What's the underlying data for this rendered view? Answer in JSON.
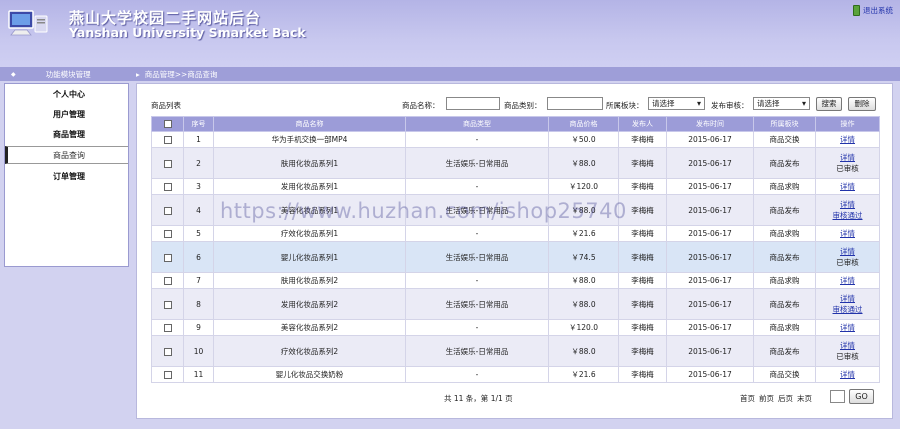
{
  "header": {
    "title_cn": "燕山大学校园二手网站后台",
    "title_en": "Yanshan University Smarket Back",
    "logout_label": "退出系统",
    "logo_icon": "monitor-icon"
  },
  "nav": {
    "left_bullet": "◆",
    "left_label": "功能模块管理",
    "right_arrow": "▸",
    "breadcrumb": "商品管理>>商品查询"
  },
  "sidebar": {
    "items": [
      {
        "label": "个人中心"
      },
      {
        "label": "用户管理"
      },
      {
        "label": "商品管理"
      },
      {
        "label": "商品查询"
      },
      {
        "label": "订单管理"
      }
    ]
  },
  "filter": {
    "list_title": "商品列表",
    "name_label": "商品名称：",
    "type_label": "商品类别：",
    "block_label": "所属板块：",
    "block_value": "请选择",
    "audit_label": "发布审核：",
    "audit_value": "请选择",
    "search_label": "搜索",
    "delete_label": "删除"
  },
  "table": {
    "headers": [
      "",
      "序号",
      "商品名称",
      "商品类型",
      "商品价格",
      "发布人",
      "发布时间",
      "所属板块",
      "操作"
    ],
    "rows": [
      {
        "no": "1",
        "name": "华为手机交换一部MP4",
        "type": "-",
        "price": "￥50.0",
        "publisher": "李梅梅",
        "date": "2015-06-17",
        "block": "商品交换",
        "op1": "详情",
        "op2": ""
      },
      {
        "no": "2",
        "name": "肤用化妆品系列1",
        "type": "生活娱乐-日常用品",
        "price": "￥88.0",
        "publisher": "李梅梅",
        "date": "2015-06-17",
        "block": "商品发布",
        "op1": "详情",
        "op2": "已审核"
      },
      {
        "no": "3",
        "name": "发用化妆品系列1",
        "type": "-",
        "price": "￥120.0",
        "publisher": "李梅梅",
        "date": "2015-06-17",
        "block": "商品求购",
        "op1": "详情",
        "op2": ""
      },
      {
        "no": "4",
        "name": "美容化妆品系列1",
        "type": "生活娱乐-日常用品",
        "price": "￥88.0",
        "publisher": "李梅梅",
        "date": "2015-06-17",
        "block": "商品发布",
        "op1": "详情",
        "op2": "审核通过"
      },
      {
        "no": "5",
        "name": "疗效化妆品系列1",
        "type": "-",
        "price": "￥21.6",
        "publisher": "李梅梅",
        "date": "2015-06-17",
        "block": "商品求购",
        "op1": "详情",
        "op2": ""
      },
      {
        "no": "6",
        "name": "婴儿化妆品系列1",
        "type": "生活娱乐-日常用品",
        "price": "￥74.5",
        "publisher": "李梅梅",
        "date": "2015-06-17",
        "block": "商品发布",
        "op1": "详情",
        "op2": "已审核"
      },
      {
        "no": "7",
        "name": "肤用化妆品系列2",
        "type": "-",
        "price": "￥88.0",
        "publisher": "李梅梅",
        "date": "2015-06-17",
        "block": "商品求购",
        "op1": "详情",
        "op2": ""
      },
      {
        "no": "8",
        "name": "发用化妆品系列2",
        "type": "生活娱乐-日常用品",
        "price": "￥88.0",
        "publisher": "李梅梅",
        "date": "2015-06-17",
        "block": "商品发布",
        "op1": "详情",
        "op2": "审核通过"
      },
      {
        "no": "9",
        "name": "美容化妆品系列2",
        "type": "-",
        "price": "￥120.0",
        "publisher": "李梅梅",
        "date": "2015-06-17",
        "block": "商品求购",
        "op1": "详情",
        "op2": ""
      },
      {
        "no": "10",
        "name": "疗效化妆品系列2",
        "type": "生活娱乐-日常用品",
        "price": "￥88.0",
        "publisher": "李梅梅",
        "date": "2015-06-17",
        "block": "商品发布",
        "op1": "详情",
        "op2": "已审核"
      },
      {
        "no": "11",
        "name": "婴儿化妆品交换奶粉",
        "type": "-",
        "price": "￥21.6",
        "publisher": "李梅梅",
        "date": "2015-06-17",
        "block": "商品交换",
        "op1": "详情",
        "op2": ""
      }
    ]
  },
  "pager": {
    "count_text": "共 11 条，第 1/1 页",
    "first": "首页",
    "prev": "前页",
    "next": "后页",
    "last": "末页",
    "go_label": "GO"
  },
  "watermark": "https://www.huzhan.com/ishop25740",
  "colors": {
    "header_bg": "#c4c4ee",
    "table_header": "#9c9cd8",
    "link": "#2233aa",
    "highlight_row": "#d9e5f6"
  }
}
